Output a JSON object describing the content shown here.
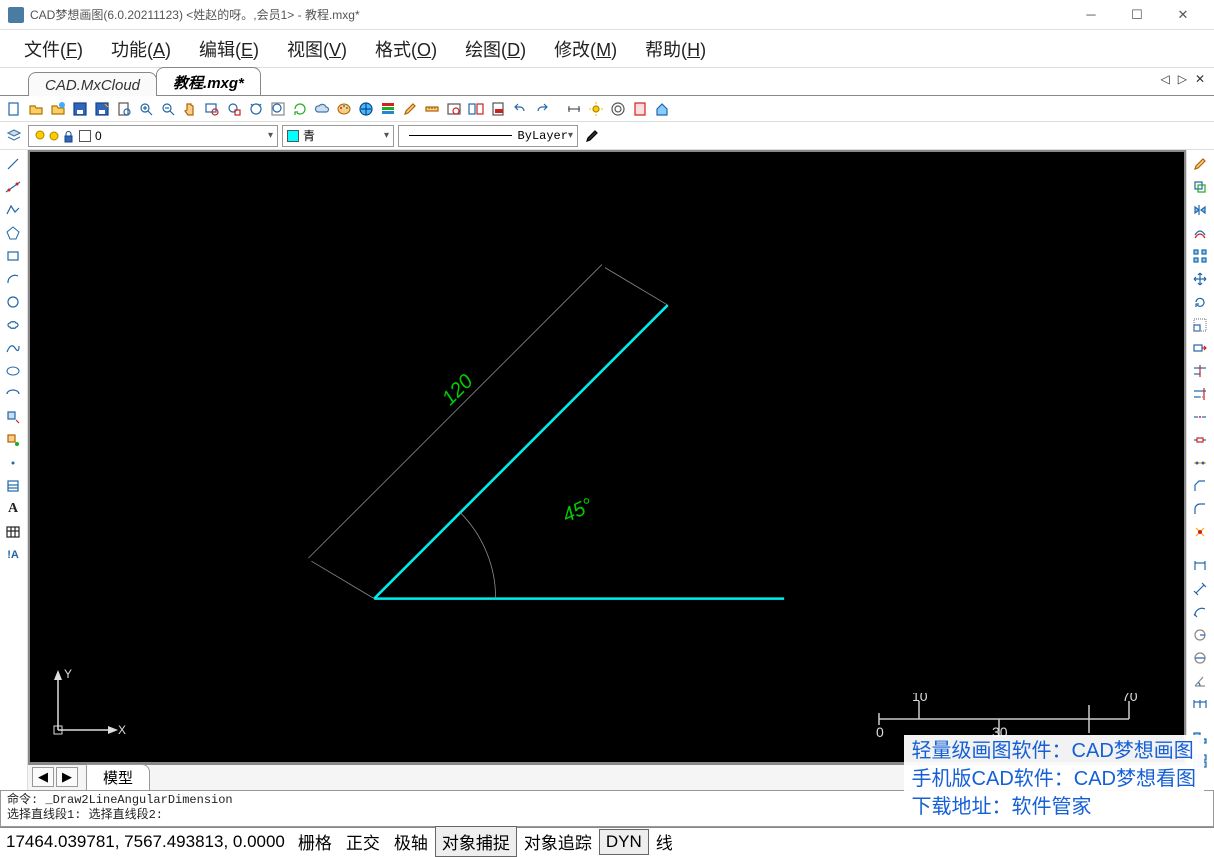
{
  "title": "CAD梦想画图(6.0.20211123) <姓赵的呀。,会员1> - 教程.mxg*",
  "menus": {
    "file": "文件(",
    "file_k": "F",
    "func": "功能(",
    "func_k": "A",
    "edit": "编辑(",
    "edit_k": "E",
    "view": "视图(",
    "view_k": "V",
    "format": "格式(",
    "format_k": "O",
    "draw": "绘图(",
    "draw_k": "D",
    "modify": "修改(",
    "modify_k": "M",
    "help": "帮助(",
    "help_k": "H",
    "close": ")"
  },
  "tabs": {
    "inactive": "CAD.MxCloud",
    "active": "教程.mxg*"
  },
  "layer": {
    "name": "0"
  },
  "color": {
    "name": "青"
  },
  "linetype": "ByLayer",
  "drawing": {
    "dim_len": "120",
    "angle": "45°"
  },
  "ruler": {
    "t1": "10",
    "t2": "70",
    "b1": "0",
    "b2": "30"
  },
  "bottomtab": "模型",
  "cmd": {
    "l1": "命令: _Draw2LineAngularDimension",
    "l2": "选择直线段1: 选择直线段2:"
  },
  "status": {
    "coords": "17464.039781, 7567.493813, 0.0000",
    "b1": "栅格",
    "b2": "正交",
    "b3": "极轴",
    "b4": "对象捕捉",
    "b5": "对象追踪",
    "b6": "DYN",
    "b7": "线"
  },
  "watermark": {
    "l1": "轻量级画图软件：CAD梦想画图",
    "l2": "手机版CAD软件：CAD梦想看图",
    "l3": "下载地址：软件管家"
  }
}
